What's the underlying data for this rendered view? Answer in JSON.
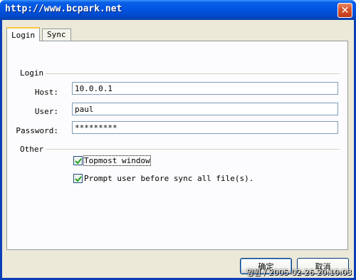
{
  "window": {
    "title": "http://www.bcpark.net"
  },
  "tabs": [
    {
      "label": "Login",
      "active": true
    },
    {
      "label": "Sync",
      "active": false
    }
  ],
  "login_group": {
    "title": "Login",
    "host_label": "Host:",
    "host_value": "10.0.0.1",
    "user_label": "User:",
    "user_value": "paul",
    "password_label": "Password:",
    "password_value": "*********"
  },
  "other_group": {
    "title": "Other",
    "topmost_label": "Topmost window",
    "topmost_checked": true,
    "prompt_label": "Prompt user before sync all file(s).",
    "prompt_checked": true
  },
  "buttons": {
    "ok_label": "确定",
    "cancel_label": "取消"
  },
  "watermark": "양원 / 2005-02-26 20:10:03",
  "colors": {
    "titlebar": "#0054e3",
    "face": "#ece9d8",
    "tab_highlight": "#ffc83c",
    "close": "#d8552c"
  }
}
